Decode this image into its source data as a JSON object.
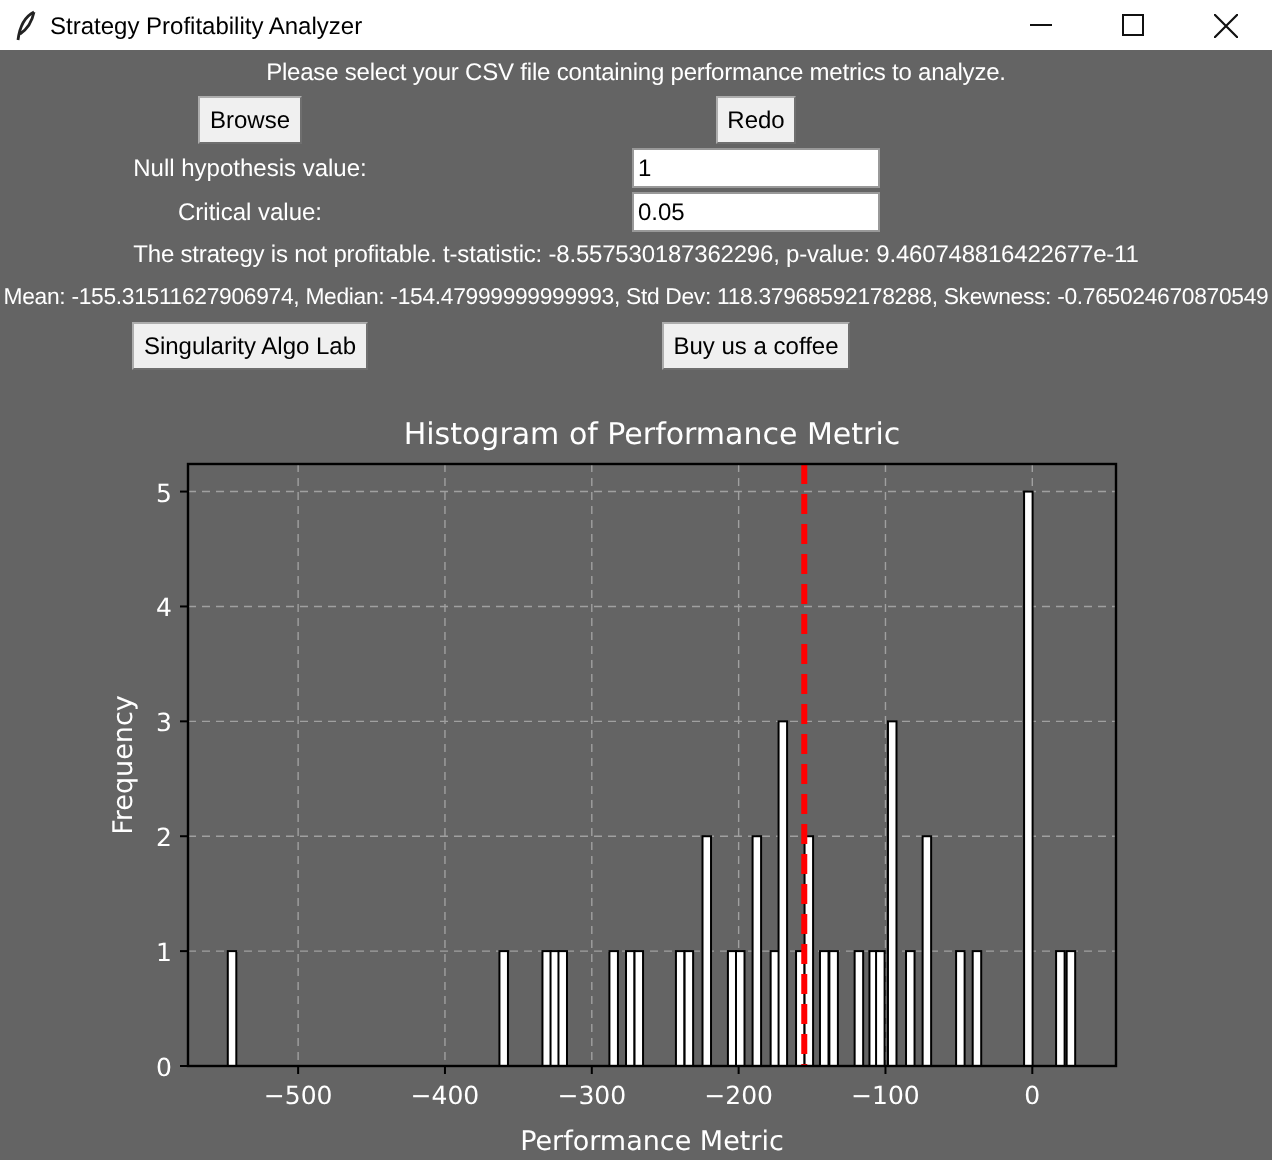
{
  "window": {
    "title": "Strategy Profitability Analyzer"
  },
  "instruction": "Please select your CSV file containing performance metrics to analyze.",
  "file_buttons": [
    "Browse",
    "Redo"
  ],
  "fields": [
    {
      "label": "Null hypothesis value:",
      "value": "1"
    },
    {
      "label": "Critical value:",
      "value": "0.05"
    }
  ],
  "result": "The strategy is not profitable. t-statistic: -8.557530187362296, p-value: 9.460748816422677e-11",
  "stats": "Mean: -155.31511627906974, Median: -154.47999999999993, Std Dev: 118.37968592178288, Skewness: -0.765024670870549",
  "link_buttons": [
    "Singularity Algo Lab",
    "Buy us a coffee"
  ],
  "chart_data": {
    "type": "bar",
    "title": "Histogram of Performance Metric",
    "xlabel": "Performance Metric",
    "ylabel": "Frequency",
    "x": [
      -545,
      -360,
      -330.7,
      -325.2,
      -319.8,
      -285.1,
      -273.8,
      -268,
      -239.8,
      -233.9,
      -221.7,
      -204.4,
      -198.9,
      -187.6,
      -175.3,
      -169.9,
      -158,
      -152.2,
      -141.7,
      -135.3,
      -118.1,
      -108,
      -103.5,
      -95.4,
      -83.1,
      -71.8,
      -49,
      -37.7,
      -2.7,
      19.1,
      26.3
    ],
    "values": [
      1,
      1,
      1,
      1,
      1,
      1,
      1,
      1,
      1,
      1,
      2,
      1,
      1,
      2,
      1,
      3,
      1,
      2,
      1,
      1,
      1,
      1,
      1,
      3,
      1,
      2,
      1,
      1,
      5,
      1,
      1
    ],
    "xlim": [
      -575,
      57
    ],
    "ylim": [
      0,
      5.24
    ],
    "xticks": [
      {
        "value": -500,
        "label": "−500"
      },
      {
        "value": -400,
        "label": "−400"
      },
      {
        "value": -300,
        "label": "−300"
      },
      {
        "value": -200,
        "label": "−200"
      },
      {
        "value": -100,
        "label": "−100"
      },
      {
        "value": 0,
        "label": "0"
      }
    ],
    "yticks": [
      0,
      1,
      2,
      3,
      4,
      5
    ],
    "grid": true,
    "ref_lines": [
      {
        "axis": "x",
        "value": -155.3,
        "color": "#ff0000"
      }
    ]
  }
}
